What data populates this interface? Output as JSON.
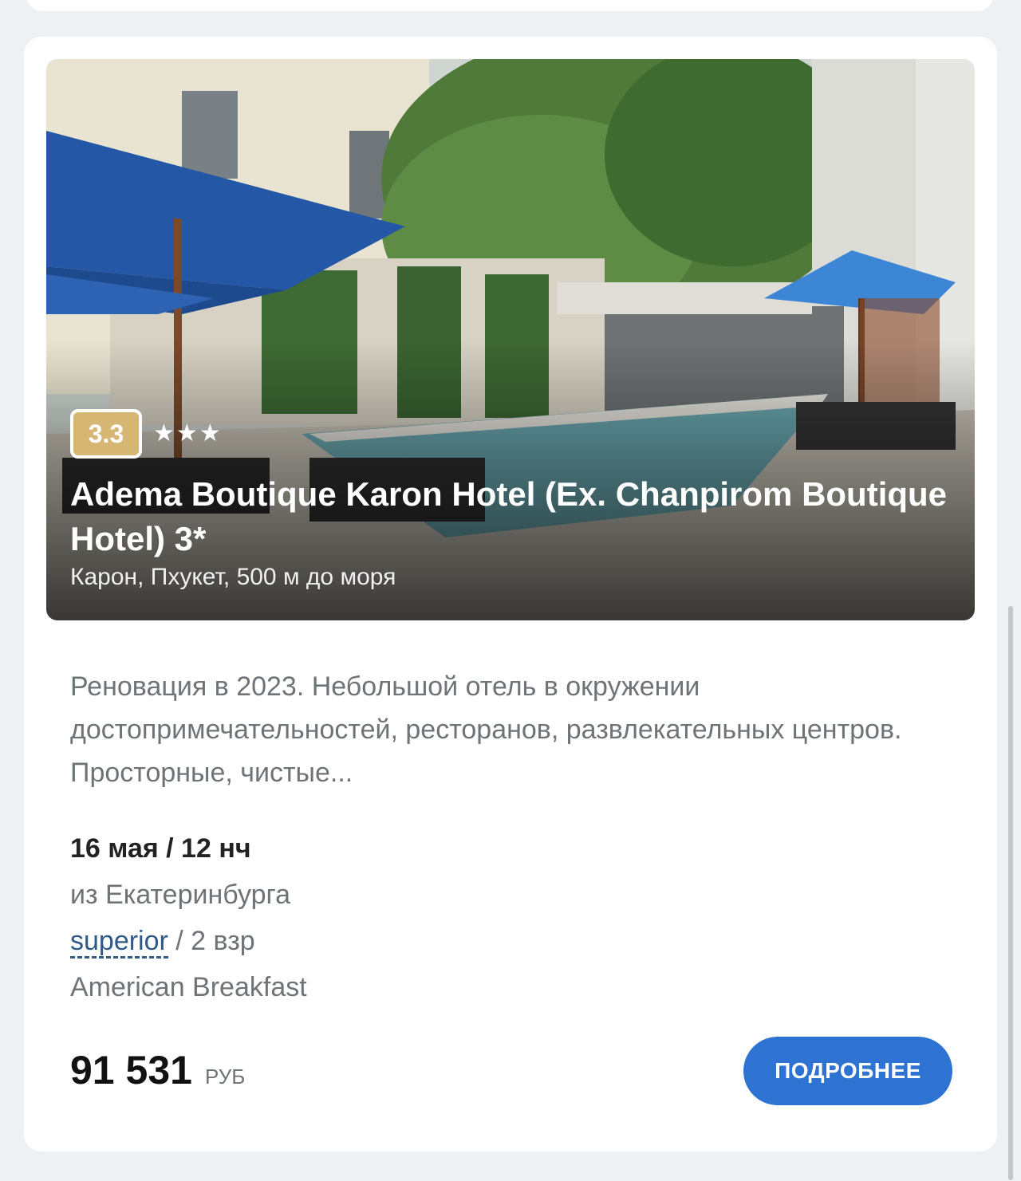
{
  "hotel": {
    "rating": "3.3",
    "stars": 3,
    "name": "Adema Boutique Karon Hotel (Ex. Chanpirom Boutique Hotel) 3*",
    "location": "Карон, Пхукет, 500 м до моря",
    "description": "Реновация в 2023. Небольшой отель в окружении достопримечательностей, ресторанов, развлекательных центров. Просторные, чистые...",
    "photo_icon": "hotel-pool-photo"
  },
  "offer": {
    "dates": "16 мая / 12 нч",
    "departure": "из Екатеринбурга",
    "room_type": "superior",
    "guests": " / 2 взр",
    "meal": "American Breakfast",
    "price": "91 531",
    "currency": "РУБ",
    "button_label": "ПОДРОБНЕЕ"
  },
  "colors": {
    "rating_badge": "#d6b673",
    "button": "#2e72d2",
    "room_link": "#2f5a86"
  }
}
